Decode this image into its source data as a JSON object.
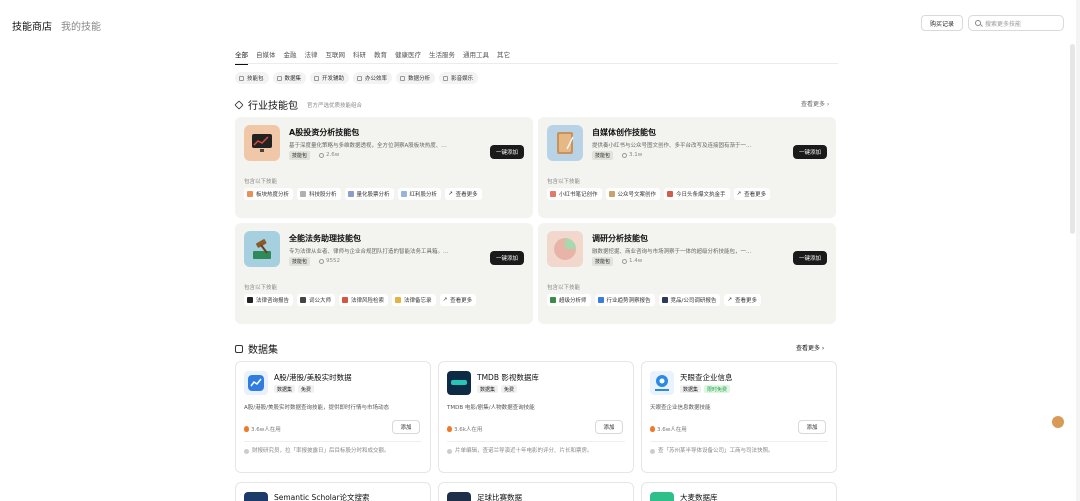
{
  "header": {
    "store": "技能商店",
    "my_skills": "我的技能",
    "buy_records": "购买记录",
    "search_placeholder": "搜索更多技能"
  },
  "tabs": [
    {
      "label": "全部",
      "active": true
    },
    {
      "label": "自媒体"
    },
    {
      "label": "金融"
    },
    {
      "label": "法律"
    },
    {
      "label": "互联网"
    },
    {
      "label": "科研"
    },
    {
      "label": "教育"
    },
    {
      "label": "健康医疗"
    },
    {
      "label": "生活服务"
    },
    {
      "label": "通用工具"
    },
    {
      "label": "其它"
    }
  ],
  "chips": [
    "技能包",
    "数据集",
    "开发辅助",
    "办公效率",
    "数据分析",
    "影音娱乐"
  ],
  "packs_section": {
    "title": "行业技能包",
    "subtitle": "官方严选优质技能组合",
    "see_more": "查看更多 ›"
  },
  "packs": [
    {
      "title": "A股投资分析技能包",
      "desc": "基于深度量化策略与多维数据透视，全方位洞察A股板块热度、…",
      "tag": "技能包",
      "count": "2.6w",
      "btn": "一键添加",
      "includes_label": "包含以下技能",
      "includes": [
        {
          "label": "板块热度分析",
          "color": "#e8925a"
        },
        {
          "label": "科技股分析",
          "color": "#b0b0b0"
        },
        {
          "label": "量化股票分析",
          "color": "#8aa0c8"
        },
        {
          "label": "红利股分析",
          "color": "#9ab3d8"
        },
        {
          "label": "查看更多",
          "color": "#777"
        }
      ]
    },
    {
      "title": "自媒体创作技能包",
      "desc": "提供奏小红书与公众号图文创作、多平台改写及连接固有渐于一…",
      "tag": "技能包",
      "count": "3.1w",
      "btn": "一键添加",
      "includes_label": "包含以下技能",
      "includes": [
        {
          "label": "小红书笔记创作",
          "color": "#e27a6a"
        },
        {
          "label": "公众号文案创作",
          "color": "#c9a36b"
        },
        {
          "label": "今日头条爆文执金手",
          "color": "#d45c4a"
        },
        {
          "label": "查看更多",
          "color": "#777"
        }
      ]
    },
    {
      "title": "全能法务助理技能包",
      "desc": "专为法律从业者、律师与企业合规团队打造的智能法务工具箱。…",
      "tag": "技能包",
      "count": "9552",
      "btn": "一键添加",
      "includes_label": "包含以下技能",
      "includes": [
        {
          "label": "法律咨询报告",
          "color": "#222"
        },
        {
          "label": "词公大师",
          "color": "#444"
        },
        {
          "label": "法律风险检索",
          "color": "#d4573f"
        },
        {
          "label": "法律备忘录",
          "color": "#e8b040"
        },
        {
          "label": "查看更多",
          "color": "#777"
        }
      ]
    },
    {
      "title": "调研分析技能包",
      "desc": "融数据挖掘、商业咨询与市场洞察于一体的超级分析技能包，一…",
      "tag": "技能包",
      "count": "1.4w",
      "btn": "一键添加",
      "includes_label": "包含以下技能",
      "includes": [
        {
          "label": "超级分析师",
          "color": "#3a8a4a"
        },
        {
          "label": "行业趋势洞察报告",
          "color": "#3a7be0"
        },
        {
          "label": "竞品/公司调研报告",
          "color": "#2a3a5a"
        },
        {
          "label": "查看更多",
          "color": "#777"
        }
      ]
    }
  ],
  "datasets_section": {
    "title": "数据集",
    "see_more": "查看更多 ›"
  },
  "datasets": [
    {
      "title": "A股/港股/美股实时数据",
      "tags": [
        "数据集",
        "免费"
      ],
      "desc": "A股/港股/美股实时数据查询技能，提供即时行情与市场动态",
      "users": "3.6w人在用",
      "btn": "添加",
      "quote": "财报研究员，拉「率报披露日」后目标股分时和成交额。"
    },
    {
      "title": "TMDB 影视数据库",
      "tags": [
        "数据集",
        "免费"
      ],
      "desc": "TMDB 电影/剧集/人物数据查询技能",
      "users": "3.6k人在用",
      "btn": "添加",
      "quote": "片单编辑，查诺兰导演近十年电影的评分、片长和票房。"
    },
    {
      "title": "天眼查企业信息",
      "tags": [
        "数据集",
        "限时免费"
      ],
      "desc": "天眼查企业信息数据技能",
      "users": "3.6w人在用",
      "btn": "添加",
      "quote": "查「苏州某半导体设备公司」工商与司法快照。"
    }
  ],
  "datasets_row2": [
    "Semantic Scholar论文搜索",
    "足球比赛数据",
    "大麦数据库"
  ],
  "colors": {
    "accent": "#1a1a1a",
    "card_bg": "#f3f3ef",
    "green_tag": "#21a04a"
  }
}
